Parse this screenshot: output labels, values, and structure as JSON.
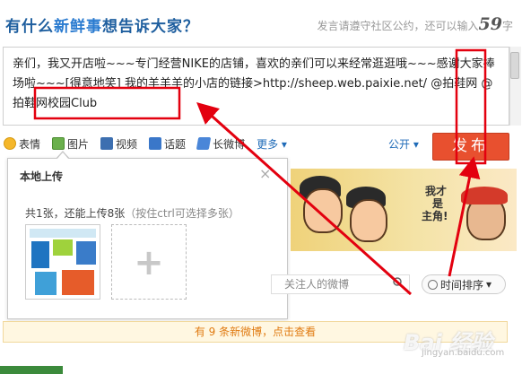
{
  "header": {
    "title_prefix": "有什么",
    "title_accent": "新鲜事",
    "title_suffix": "想告诉大家？",
    "hint_prefix": "发言请遵守社区公约，还可以输入",
    "hint_count": "59",
    "hint_suffix": "字"
  },
  "composer": {
    "text": "亲们，我又开店啦~~~专门经营NIKE的店铺，喜欢的亲们可以来经常逛逛哦~~~感谢大家捧场啦~~~[得意地笑] 我的羊羊羊的小店的链接>http://sheep.web.paixie.net/ @拍鞋网 @拍鞋网校园Club"
  },
  "toolbar": {
    "emoji": "表情",
    "picture": "图片",
    "video": "视频",
    "topic": "话题",
    "long_weibo": "长微博",
    "more": "更多 ▾",
    "public": "公开 ▾",
    "publish": "发布"
  },
  "upload_popup": {
    "title": "本地上传",
    "close": "×",
    "info_main": "共1张，还能上传8张",
    "info_hint": "（按住ctrl可选择多张）",
    "add": "+"
  },
  "banner": {
    "bubble_text_1": "我才",
    "bubble_text_2": "是",
    "bubble_text_3": "主角!"
  },
  "feed": {
    "search_placeholder": "关注人的微博",
    "sort_label": "时间排序",
    "new_notice": "有 9 条新微博，点击查看"
  },
  "watermark": {
    "brand": "Bai 经验",
    "url": "jingyan.baidu.com"
  },
  "colors": {
    "accent_blue": "#1f6bb8",
    "publish_red": "#e8502f",
    "annotation_red": "#e3000f"
  }
}
